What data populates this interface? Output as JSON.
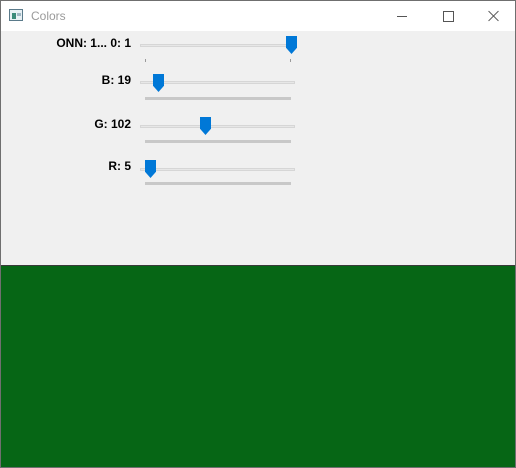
{
  "window": {
    "title": "Colors"
  },
  "trackbars": [
    {
      "id": "onoff",
      "label": "ONN: 1... 0: 1",
      "value": 1,
      "min": 0,
      "max": 1
    },
    {
      "id": "b",
      "label": "B: 19",
      "value": 19,
      "min": 0,
      "max": 255
    },
    {
      "id": "g",
      "label": "G: 102",
      "value": 102,
      "min": 0,
      "max": 255
    },
    {
      "id": "r",
      "label": "R: 5",
      "value": 5,
      "min": 0,
      "max": 255
    }
  ],
  "preview": {
    "color": "#066615"
  },
  "icons": {
    "app": "app-window-icon",
    "minimize": "minimize-icon",
    "maximize": "maximize-icon",
    "close": "close-icon"
  }
}
